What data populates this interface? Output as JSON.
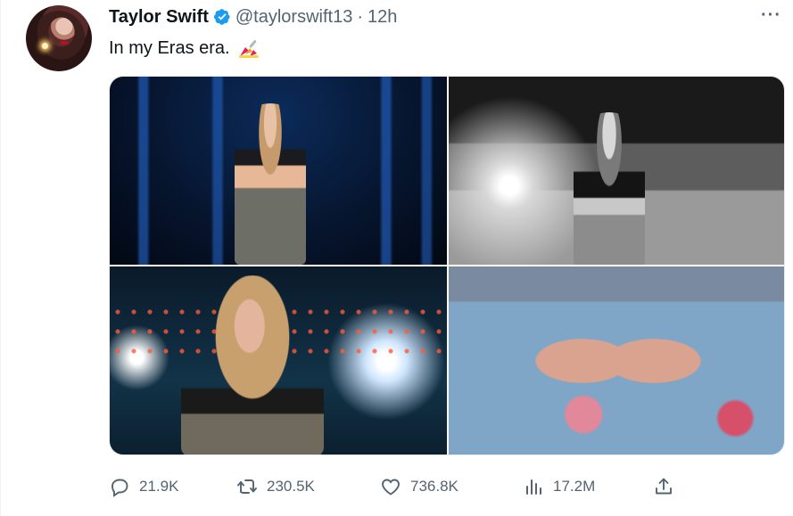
{
  "tweet": {
    "author_name": "Taylor Swift",
    "handle": "@taylorswift13",
    "separator": "·",
    "timestamp": "12h",
    "more_label": "···",
    "text": "In my Eras era.",
    "emoji_icon": "nail-polish-icon"
  },
  "media": {
    "photo_count": 4,
    "photos": [
      {
        "icon": "concert-photo"
      },
      {
        "icon": "concert-photo-bw"
      },
      {
        "icon": "concert-photo-singing"
      },
      {
        "icon": "overalls-hands-photo"
      }
    ]
  },
  "metrics": {
    "replies": "21.9K",
    "reposts": "230.5K",
    "likes": "736.8K",
    "views": "17.2M"
  },
  "icons": {
    "reply": "reply-icon",
    "repost": "repost-icon",
    "like": "like-icon",
    "views": "views-icon",
    "share": "share-icon"
  },
  "colors": {
    "text_primary": "#0f1419",
    "text_secondary": "#536471",
    "verified_blue": "#1d9bf0"
  }
}
